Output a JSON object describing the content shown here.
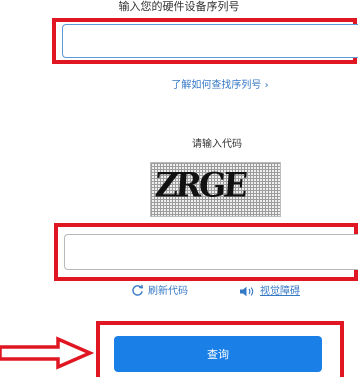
{
  "serial": {
    "label": "输入您的硬件设备序列号",
    "input_value": "",
    "find_link": "了解如何查找序列号 ›"
  },
  "code": {
    "label": "请输入代码",
    "captcha_text": "ZRGE",
    "input_value": "",
    "refresh_label": "刷新代码",
    "audio_label": "视觉障碍"
  },
  "submit": {
    "label": "查询"
  },
  "colors": {
    "highlight": "#e01722",
    "accent": "#1a7fe6",
    "link": "#3478c6"
  },
  "icons": [
    "refresh-icon",
    "speaker-icon",
    "pointer-arrow-icon"
  ]
}
